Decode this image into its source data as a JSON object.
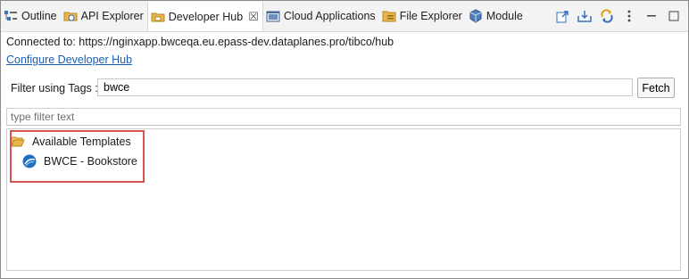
{
  "tabs": [
    {
      "label": "Outline",
      "icon": "outline-icon"
    },
    {
      "label": "API Explorer",
      "icon": "api-explorer-icon"
    },
    {
      "label": "Developer Hub",
      "icon": "developer-hub-icon",
      "active": true,
      "close": "☒"
    },
    {
      "label": "Cloud Applications",
      "icon": "cloud-applications-icon"
    },
    {
      "label": "File Explorer",
      "icon": "file-explorer-icon"
    },
    {
      "label": "Module",
      "icon": "module-icon"
    }
  ],
  "toolbar": {
    "icons": [
      "export-icon",
      "import-icon",
      "sync-icon",
      "view-menu-icon",
      "minimize-icon",
      "maximize-icon"
    ]
  },
  "connection": {
    "text": "Connected to: https://nginxapp.bwceqa.eu.epass-dev.dataplanes.pro/tibco/hub"
  },
  "configure_link": "Configure Developer Hub",
  "filter": {
    "label": "Filter using Tags :",
    "value": "bwce",
    "fetch_label": "Fetch"
  },
  "search": {
    "placeholder": "type filter text"
  },
  "tree": {
    "folder_label": "Available Templates",
    "items": [
      {
        "label": "BWCE - Bookstore",
        "icon": "bwce-icon"
      }
    ]
  },
  "colors": {
    "link": "#1a5fb4",
    "highlight_border": "#d9534f",
    "folder": "#e8b64a"
  }
}
